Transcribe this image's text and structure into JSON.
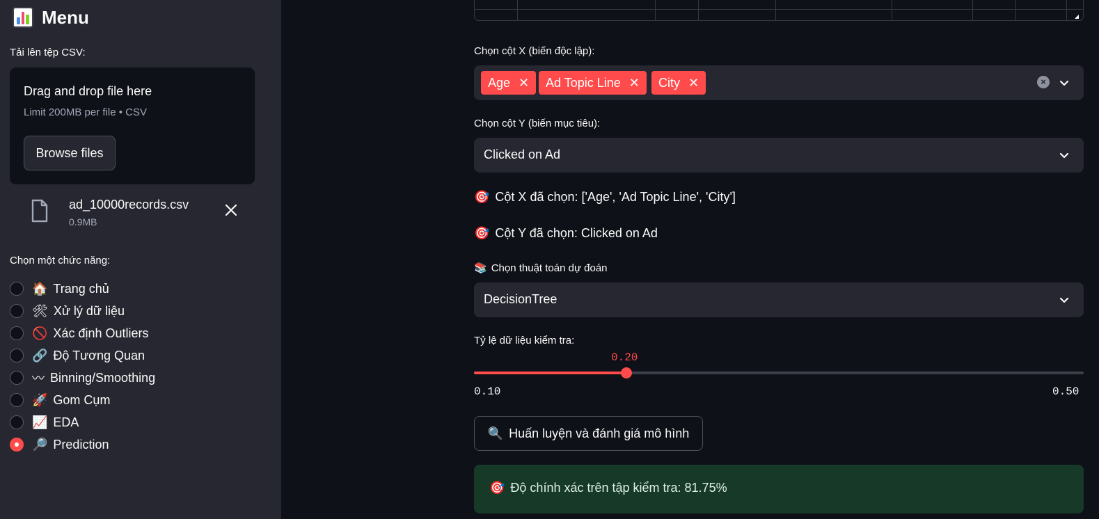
{
  "sidebar": {
    "title": "Menu",
    "upload_label": "Tải lên tệp CSV:",
    "dropzone": {
      "title": "Drag and drop file here",
      "subtitle": "Limit 200MB per file • CSV",
      "browse_label": "Browse files"
    },
    "file": {
      "name": "ad_10000records.csv",
      "size": "0.9MB"
    },
    "radio_label": "Chọn một chức năng:",
    "options": [
      {
        "emoji": "🏠",
        "label": "Trang chủ",
        "selected": false
      },
      {
        "emoji": "🛠",
        "label": "Xử lý dữ liệu",
        "selected": false
      },
      {
        "emoji": "🚫",
        "label": "Xác định Outliers",
        "selected": false
      },
      {
        "emoji": "🔗",
        "label": "Độ Tương Quan",
        "selected": false
      },
      {
        "emoji": "〰",
        "label": "Binning/Smoothing",
        "selected": false
      },
      {
        "emoji": "🚀",
        "label": "Gom Cụm",
        "selected": false
      },
      {
        "emoji": "📈",
        "label": "EDA",
        "selected": false
      },
      {
        "emoji": "🔎",
        "label": "Prediction",
        "selected": true
      }
    ]
  },
  "main": {
    "x_label": "Chọn cột X (biến độc lập):",
    "x_tags": [
      "Age",
      "Ad Topic Line",
      "City"
    ],
    "y_label": "Chọn cột Y (biến mục tiêu):",
    "y_value": "Clicked on Ad",
    "x_selected": {
      "emoji": "🎯",
      "text": "Cột X đã chọn: ['Age', 'Ad Topic Line', 'City']"
    },
    "y_selected": {
      "emoji": "🎯",
      "text": "Cột Y đã chọn: Clicked on Ad"
    },
    "algo_label": {
      "emoji": "📚",
      "text": "Chọn thuật toán dự đoán"
    },
    "algo_value": "DecisionTree",
    "slider": {
      "label": "Tỷ lệ dữ liệu kiểm tra:",
      "value": "0.20",
      "min": "0.10",
      "max": "0.50",
      "fraction": 0.25
    },
    "train_button": {
      "emoji": "🔍",
      "label": "Huấn luyện và đánh giá mô hình"
    },
    "result": {
      "emoji": "🎯",
      "text": "Độ chính xác trên tập kiểm tra: 81.75%"
    }
  },
  "colors": {
    "accent": "#ff4b4b",
    "sidebar_bg": "#262730",
    "main_bg": "#0e1117",
    "success_bg": "#173928"
  }
}
